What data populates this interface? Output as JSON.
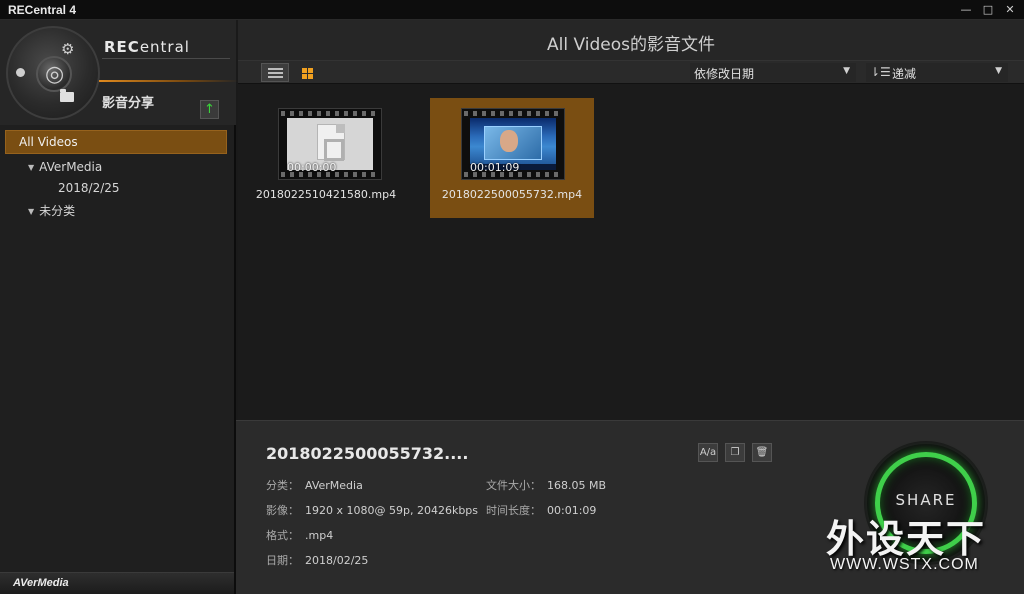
{
  "window": {
    "title": "RECentral 4",
    "controls": {
      "minimize": "—",
      "maximize": "□",
      "close": "✕"
    }
  },
  "sidebar": {
    "logo_text_a": "REC",
    "logo_text_b": "entral",
    "section_label": "影音分享",
    "upload_icon": "↑",
    "tree": {
      "selected": "All Videos",
      "items": [
        {
          "label": "AVerMedia",
          "expanded": true
        },
        {
          "label": "2018/2/25"
        },
        {
          "label": "未分类",
          "expanded": true
        }
      ]
    },
    "footer_brand": "AVerMedia"
  },
  "main": {
    "title": "All Videos的影音文件",
    "sort_field": "依修改日期",
    "sort_order": "递减",
    "videos": [
      {
        "filename": "2018022510421580.mp4",
        "duration": "00:00:00",
        "selected": false
      },
      {
        "filename": "2018022500055732.mp4",
        "duration": "00:01:09",
        "selected": true
      }
    ]
  },
  "details": {
    "title": "2018022500055732....",
    "category_key": "分类：",
    "category_val": "AVerMedia",
    "video_key": "影像：",
    "video_val": "1920 x 1080@ 59p, 20426kbps",
    "format_key": "格式：",
    "format_val": ".mp4",
    "date_key": "日期：",
    "date_val": "2018/02/25",
    "size_key": "文件大小：",
    "size_val": "168.05 MB",
    "length_key": "时间长度：",
    "length_val": "00:01:09",
    "share_label": "SHARE"
  },
  "watermark": {
    "text": "外设天下",
    "url": "WWW.WSTX.COM"
  },
  "colors": {
    "accent_orange": "#7a4e12",
    "share_green": "#3fcf4a"
  }
}
